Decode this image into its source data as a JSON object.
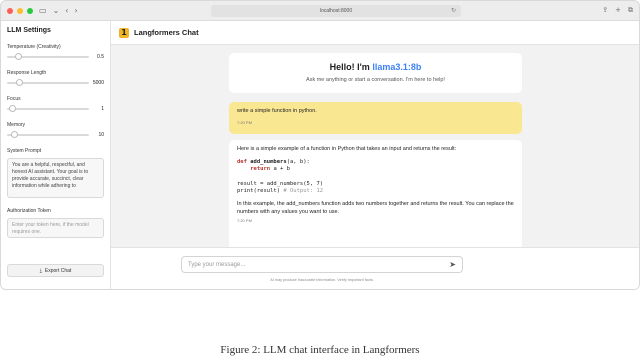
{
  "browser": {
    "url": "localhost:8000",
    "reload_icon": "reload-icon"
  },
  "sidebar": {
    "title": "LLM Settings",
    "settings": [
      {
        "label": "Temperature (Creativity)",
        "value": "0.5",
        "fraction": 0.1
      },
      {
        "label": "Response Length",
        "value": "5000",
        "fraction": 0.12
      },
      {
        "label": "Focus",
        "value": "1",
        "fraction": 0.02
      },
      {
        "label": "Memory",
        "value": "10",
        "fraction": 0.05
      }
    ],
    "system_prompt_label": "System Prompt",
    "system_prompt_value": "You are a helpful, respectful, and honest AI assistant. Your goal is to provide accurate, succinct, clear information while adhering to",
    "auth_label": "Authorization Token",
    "auth_placeholder": "Enter your token here, if the model requires one.",
    "export_label": "Export Chat"
  },
  "header": {
    "logo_text": "1",
    "title": "Langformers Chat"
  },
  "welcome": {
    "title_prefix": "Hello! I'm ",
    "model_name": "llama3.1:8b",
    "subtitle": "Ask me anything or start a conversation. I'm here to help!"
  },
  "messages": [
    {
      "role": "user",
      "text": "write a simple function in python.",
      "time": "7:20 PM"
    },
    {
      "role": "assistant",
      "intro": "Here is a simple example of a function in Python that takes an input and returns the result:",
      "code": {
        "line1_kw": "def",
        "line1_fn": "add_numbers",
        "line1_rest": "(a, b):",
        "line2_kw": "return",
        "line2_rest": "a + b",
        "line3": "result = add_numbers(5, 7)",
        "line4_code": "print(result)",
        "line4_comment": "# Output: 12"
      },
      "outro": "In this example, the add_numbers function adds two numbers together and returns the result. You can replace the numbers with any values you want to use.",
      "time": "7:20 PM"
    }
  ],
  "composer": {
    "placeholder": "Type your message...",
    "disclaimer": "AI may produce inaccurate information. Verify important facts."
  },
  "caption": "Figure 2: LLM chat interface in Langformers"
}
